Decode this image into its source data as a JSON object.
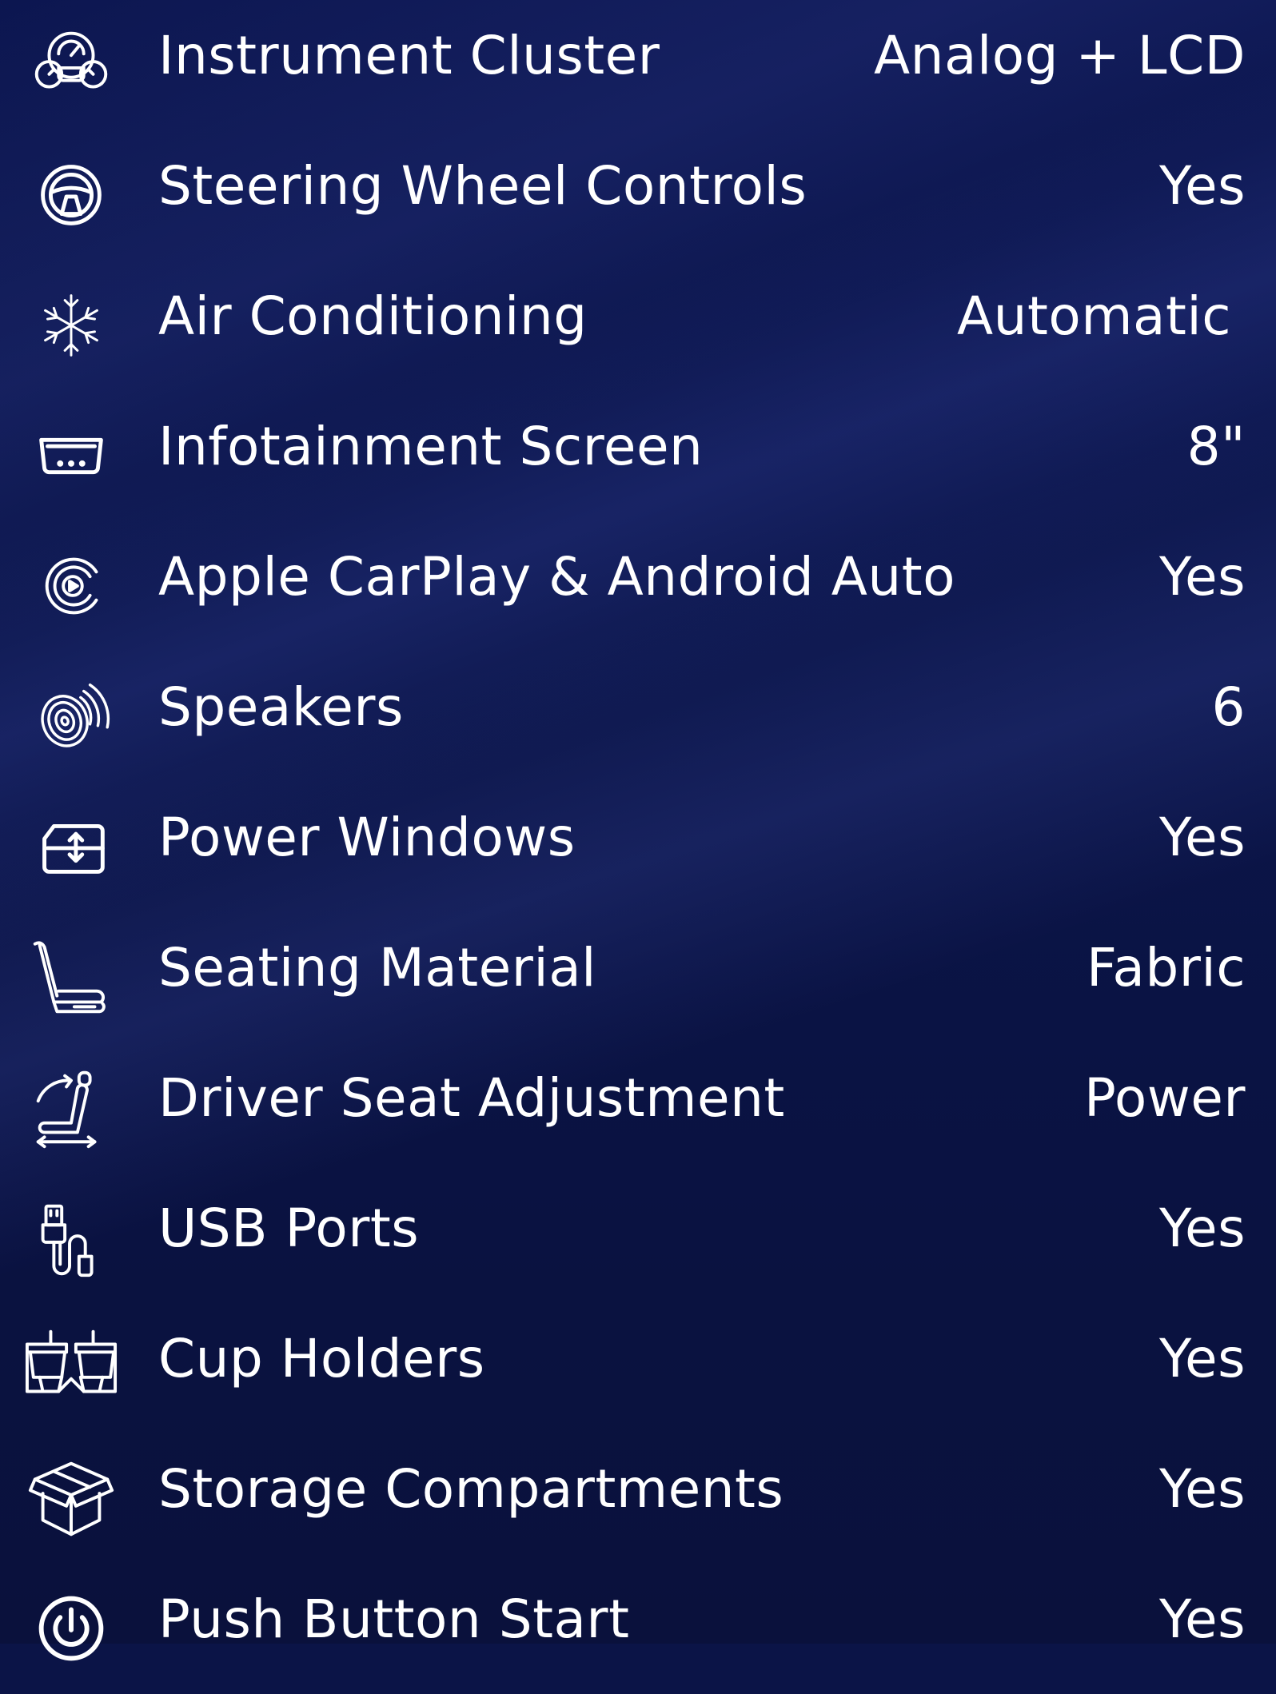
{
  "colors": {
    "background": "#0b1447",
    "text": "#ffffff",
    "icon": "#ffffff"
  },
  "features": [
    {
      "label": "Instrument Cluster",
      "value": "Analog + LCD",
      "icon": "gauge-icon"
    },
    {
      "label": "Steering Wheel Controls",
      "value": "Yes",
      "icon": "steering-wheel-icon"
    },
    {
      "label": "Air Conditioning",
      "value": "Automatic",
      "icon": "snowflake-icon"
    },
    {
      "label": "Infotainment Screen",
      "value": "8\"",
      "icon": "screen-icon"
    },
    {
      "label": "Apple CarPlay & Android Auto",
      "value": "Yes",
      "icon": "carplay-icon"
    },
    {
      "label": "Speakers",
      "value": "6",
      "icon": "speaker-icon"
    },
    {
      "label": "Power Windows",
      "value": "Yes",
      "icon": "power-window-icon"
    },
    {
      "label": "Seating Material",
      "value": "Fabric",
      "icon": "seat-icon"
    },
    {
      "label": "Driver Seat Adjustment",
      "value": "Power",
      "icon": "seat-adjust-icon"
    },
    {
      "label": "USB Ports",
      "value": "Yes",
      "icon": "usb-icon"
    },
    {
      "label": "Cup Holders",
      "value": "Yes",
      "icon": "cup-holder-icon"
    },
    {
      "label": "Storage Compartments",
      "value": "Yes",
      "icon": "storage-box-icon"
    },
    {
      "label": "Push Button Start",
      "value": "Yes",
      "icon": "power-button-icon"
    }
  ]
}
